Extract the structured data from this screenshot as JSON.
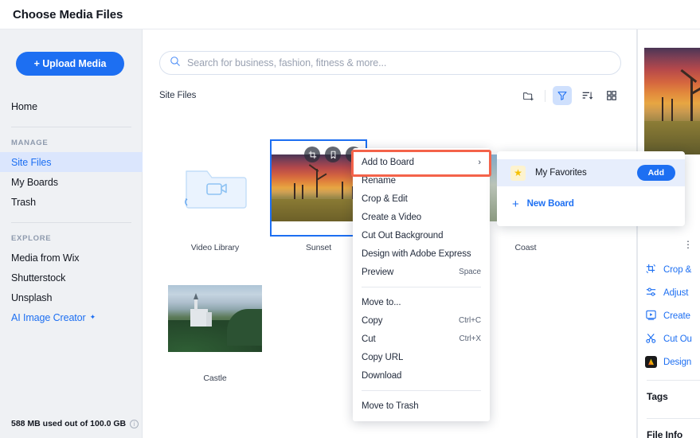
{
  "header": {
    "title": "Choose Media Files"
  },
  "sidebar": {
    "upload_label": "+ Upload Media",
    "home_label": "Home",
    "manage_label": "MANAGE",
    "manage_items": [
      {
        "label": "Site Files",
        "active": true
      },
      {
        "label": "My Boards",
        "active": false
      },
      {
        "label": "Trash",
        "active": false
      }
    ],
    "explore_label": "EXPLORE",
    "explore_items": [
      {
        "label": "Media from Wix",
        "blue": false
      },
      {
        "label": "Shutterstock",
        "blue": false
      },
      {
        "label": "Unsplash",
        "blue": false
      },
      {
        "label": "AI Image Creator",
        "blue": true
      }
    ],
    "storage_text": "588 MB used out of 100.0 GB",
    "info_glyph": "i"
  },
  "search": {
    "placeholder": "Search for business, fashion, fitness & more...",
    "value": "",
    "icon": "search-icon"
  },
  "toolbar": {
    "breadcrumb": "Site Files",
    "icons": [
      {
        "name": "new-folder-icon",
        "active": false
      },
      {
        "name": "filter-icon",
        "active": true
      },
      {
        "name": "sort-icon",
        "active": false
      },
      {
        "name": "grid-view-icon",
        "active": false
      }
    ]
  },
  "files": [
    {
      "label": "Video Library",
      "type": "folder",
      "selected": false
    },
    {
      "label": "Sunset",
      "type": "image",
      "selected": true
    },
    {
      "label": "Coast",
      "type": "image",
      "selected": false
    },
    {
      "label": "Castle",
      "type": "image",
      "selected": false
    }
  ],
  "thumb_overlay": [
    {
      "name": "crop-icon"
    },
    {
      "name": "bookmark-icon"
    },
    {
      "name": "more-icon"
    }
  ],
  "context_menu": {
    "items": [
      {
        "label": "Add to Board",
        "shortcut": "",
        "submenu": true,
        "highlighted": true
      },
      {
        "label": "Rename",
        "shortcut": "",
        "submenu": false
      },
      {
        "label": "Crop & Edit",
        "shortcut": "",
        "submenu": false
      },
      {
        "label": "Create a Video",
        "shortcut": "",
        "submenu": false
      },
      {
        "label": "Cut Out Background",
        "shortcut": "",
        "submenu": false
      },
      {
        "label": "Design with Adobe Express",
        "shortcut": "",
        "submenu": false
      },
      {
        "label": "Preview",
        "shortcut": "Space",
        "submenu": false
      }
    ],
    "items2": [
      {
        "label": "Move to...",
        "shortcut": ""
      },
      {
        "label": "Copy",
        "shortcut": "Ctrl+C"
      },
      {
        "label": "Cut",
        "shortcut": "Ctrl+X"
      },
      {
        "label": "Copy URL",
        "shortcut": ""
      },
      {
        "label": "Download",
        "shortcut": ""
      }
    ],
    "items3": [
      {
        "label": "Move to Trash",
        "shortcut": ""
      }
    ],
    "chevron": "›",
    "highlight_color": "#f4634a"
  },
  "submenu": {
    "board_name": "My Favorites",
    "add_label": "Add",
    "new_board_label": "New Board",
    "plus": "+",
    "star": "★"
  },
  "right_panel": {
    "kebab": "⋮",
    "actions": [
      {
        "label": "Crop &",
        "icon": "crop-icon"
      },
      {
        "label": "Adjust",
        "icon": "adjust-icon"
      },
      {
        "label": "Create",
        "icon": "create-video-icon"
      },
      {
        "label": "Cut Ou",
        "icon": "scissors-icon"
      },
      {
        "label": "Design",
        "icon": "adobe-express-icon"
      }
    ],
    "tags_label": "Tags",
    "file_info_label": "File Info"
  },
  "colors": {
    "accent": "#1d6ff2",
    "highlight": "#f4634a",
    "sidebar_bg": "#eff1f4",
    "active_nav_bg": "#dbe6fd"
  }
}
